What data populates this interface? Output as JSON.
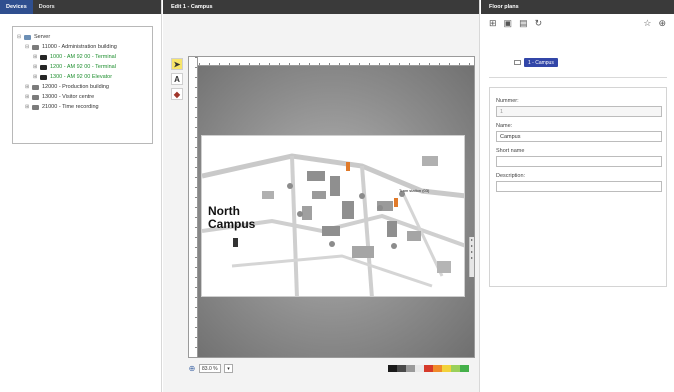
{
  "left": {
    "tabs": [
      {
        "label": "Devices"
      },
      {
        "label": "Doors"
      }
    ],
    "tree": [
      {
        "label": "Server"
      },
      {
        "label": "11000 - Administration building"
      },
      {
        "label": "1000 - AM 92 00 - Terminal"
      },
      {
        "label": "1200 - AM 92 00 - Terminal"
      },
      {
        "label": "1300 - AM 92 00 Elevator"
      },
      {
        "label": "12000 - Production building"
      },
      {
        "label": "13000 - Visitor centre"
      },
      {
        "label": "21000 - Time recording"
      }
    ]
  },
  "center": {
    "title": "Edit 1 - Campus",
    "tools": [
      {
        "icon": "pointer-icon",
        "glyph": "➤"
      },
      {
        "icon": "text-tool-icon",
        "glyph": "A"
      },
      {
        "icon": "marker-tool-icon",
        "glyph": "◆"
      }
    ],
    "map": {
      "campus_label_1": "North",
      "campus_label_2": "Campus",
      "station_label": "Tram station (03)"
    },
    "zoom": {
      "value": "83.0 %",
      "dropdown": "▾"
    },
    "palette": [
      "#1a1a1a",
      "#4a4a4a",
      "#9a9a9a",
      "#e9e9e9",
      "#d63a2a",
      "#f08a2a",
      "#f2d23a",
      "#9ad05a",
      "#45b04a"
    ]
  },
  "right": {
    "title": "Floor plans",
    "floor_item": "1 - Campus",
    "form": {
      "number_label": "Nummer:",
      "number_value": "1",
      "name_label": "Name:",
      "name_value": "Campus",
      "short_name_label": "Short name",
      "short_name_value": "",
      "description_label": "Description:",
      "description_value": ""
    }
  },
  "colors": {
    "header_bg": "#3a3a3a",
    "active_tab": "#2f4f8f",
    "terminal_green": "#1f8f2f",
    "chip_blue": "#3246a8"
  }
}
